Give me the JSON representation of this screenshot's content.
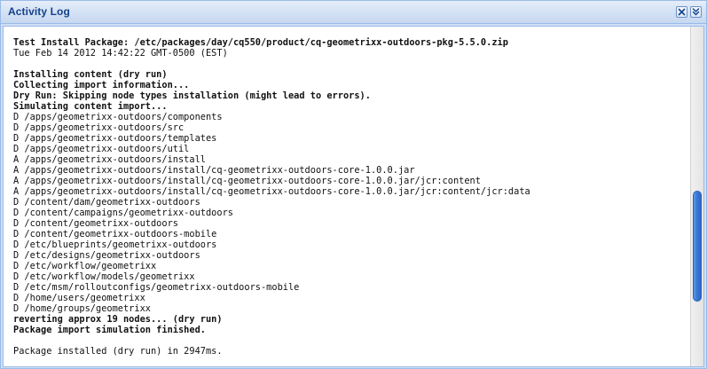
{
  "panel": {
    "title": "Activity Log",
    "tools": {
      "close_icon": "close-icon",
      "collapse_icon": "double-chevron-down-icon"
    }
  },
  "log": {
    "lines": [
      {
        "text": "Test Install Package: /etc/packages/day/cq550/product/cq-geometrixx-outdoors-pkg-5.5.0.zip",
        "bold": true
      },
      {
        "text": "Tue Feb 14 2012 14:42:22 GMT-0500 (EST)",
        "bold": false
      },
      {
        "text": "",
        "bold": false
      },
      {
        "text": "Installing content (dry run)",
        "bold": true
      },
      {
        "text": "Collecting import information...",
        "bold": true
      },
      {
        "text": "Dry Run: Skipping node types installation (might lead to errors).",
        "bold": true
      },
      {
        "text": "Simulating content import...",
        "bold": true
      },
      {
        "text": "D /apps/geometrixx-outdoors/components",
        "bold": false
      },
      {
        "text": "D /apps/geometrixx-outdoors/src",
        "bold": false
      },
      {
        "text": "D /apps/geometrixx-outdoors/templates",
        "bold": false
      },
      {
        "text": "D /apps/geometrixx-outdoors/util",
        "bold": false
      },
      {
        "text": "A /apps/geometrixx-outdoors/install",
        "bold": false
      },
      {
        "text": "A /apps/geometrixx-outdoors/install/cq-geometrixx-outdoors-core-1.0.0.jar",
        "bold": false
      },
      {
        "text": "A /apps/geometrixx-outdoors/install/cq-geometrixx-outdoors-core-1.0.0.jar/jcr:content",
        "bold": false
      },
      {
        "text": "A /apps/geometrixx-outdoors/install/cq-geometrixx-outdoors-core-1.0.0.jar/jcr:content/jcr:data",
        "bold": false
      },
      {
        "text": "D /content/dam/geometrixx-outdoors",
        "bold": false
      },
      {
        "text": "D /content/campaigns/geometrixx-outdoors",
        "bold": false
      },
      {
        "text": "D /content/geometrixx-outdoors",
        "bold": false
      },
      {
        "text": "D /content/geometrixx-outdoors-mobile",
        "bold": false
      },
      {
        "text": "D /etc/blueprints/geometrixx-outdoors",
        "bold": false
      },
      {
        "text": "D /etc/designs/geometrixx-outdoors",
        "bold": false
      },
      {
        "text": "D /etc/workflow/geometrixx",
        "bold": false
      },
      {
        "text": "D /etc/workflow/models/geometrixx",
        "bold": false
      },
      {
        "text": "D /etc/msm/rolloutconfigs/geometrixx-outdoors-mobile",
        "bold": false
      },
      {
        "text": "D /home/users/geometrixx",
        "bold": false
      },
      {
        "text": "D /home/groups/geometrixx",
        "bold": false
      },
      {
        "text": "reverting approx 19 nodes... (dry run)",
        "bold": true
      },
      {
        "text": "Package import simulation finished.",
        "bold": true
      },
      {
        "text": "",
        "bold": false
      },
      {
        "text": "Package installed (dry run) in 2947ms.",
        "bold": false
      }
    ]
  },
  "scroll": {
    "position": 0.72,
    "visible_fraction": 0.33
  },
  "colors": {
    "header_text": "#15428b",
    "border": "#99bbe8",
    "scroll_thumb": "#3a78d6"
  }
}
